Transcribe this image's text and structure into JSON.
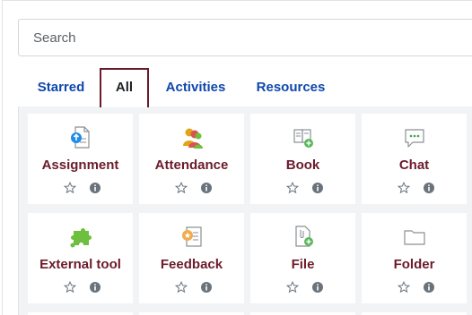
{
  "search": {
    "placeholder": "Search"
  },
  "tabs": [
    {
      "label": "Starred"
    },
    {
      "label": "All"
    },
    {
      "label": "Activities"
    },
    {
      "label": "Resources"
    }
  ],
  "modules": [
    {
      "label": "Assignment",
      "icon": "assignment-icon"
    },
    {
      "label": "Attendance",
      "icon": "attendance-icon"
    },
    {
      "label": "Book",
      "icon": "book-icon"
    },
    {
      "label": "Chat",
      "icon": "chat-icon"
    },
    {
      "label": "External tool",
      "icon": "external-tool-icon"
    },
    {
      "label": "Feedback",
      "icon": "feedback-icon"
    },
    {
      "label": "File",
      "icon": "file-icon"
    },
    {
      "label": "Folder",
      "icon": "folder-icon"
    }
  ],
  "colors": {
    "accent": "#6b1b2a",
    "link": "#0f47ad",
    "grid_background": "#f1f3f5"
  }
}
